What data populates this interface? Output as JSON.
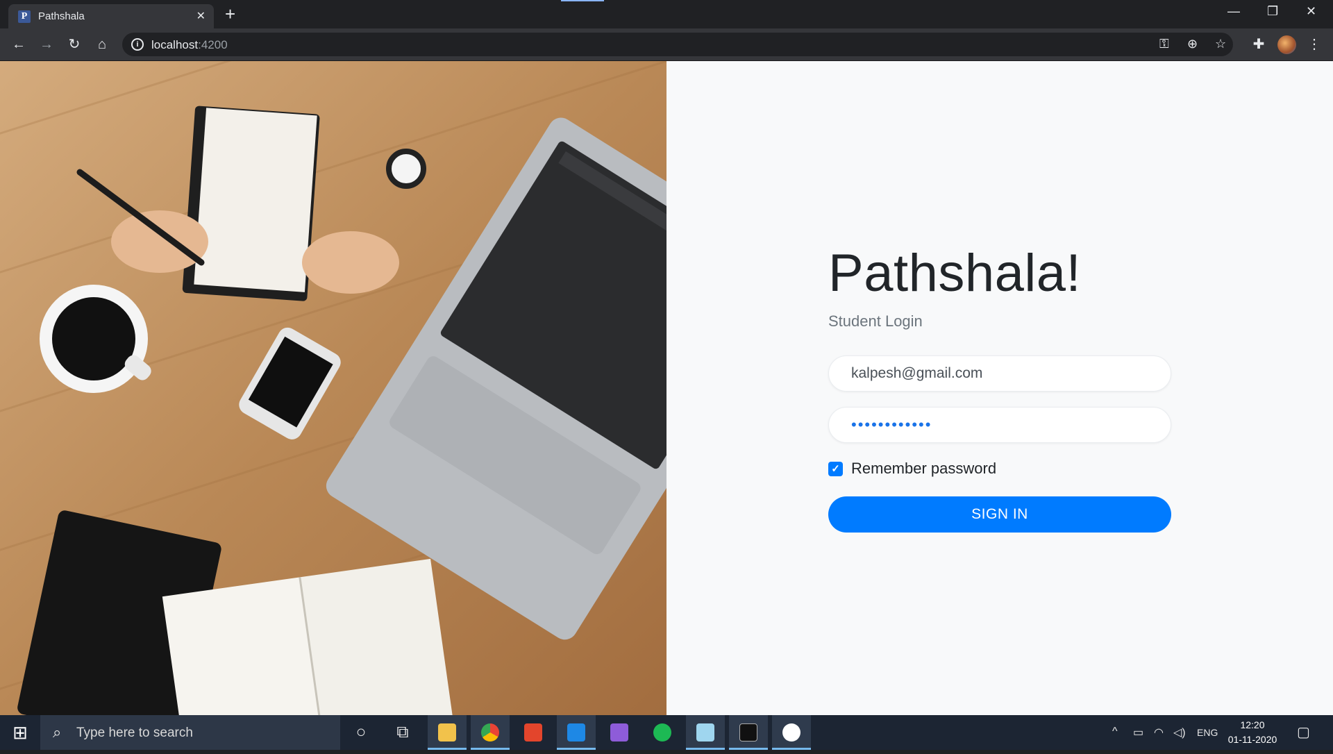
{
  "browser": {
    "tab_title": "Pathshala",
    "tab_favicon": "P",
    "url_host": "localhost",
    "url_port": ":4200"
  },
  "login": {
    "brand": "Pathshala!",
    "subtitle": "Student Login",
    "email_value": "kalpesh@gmail.com",
    "password_value": "kalpesh12345",
    "remember_label": "Remember password",
    "remember_checked": true,
    "signin_label": "SIGN IN"
  },
  "taskbar": {
    "search_placeholder": "Type here to search",
    "language": "ENG",
    "time": "12:20",
    "date": "01-11-2020",
    "apps": [
      "task-view",
      "file-explorer",
      "chrome",
      "office",
      "vscode",
      "visual-studio",
      "spotify",
      "notepad",
      "terminal",
      "mongodb-compass"
    ]
  },
  "colors": {
    "accent": "#007bff",
    "page_bg": "#f8f9fa",
    "taskbar_bg": "#1c2533"
  }
}
